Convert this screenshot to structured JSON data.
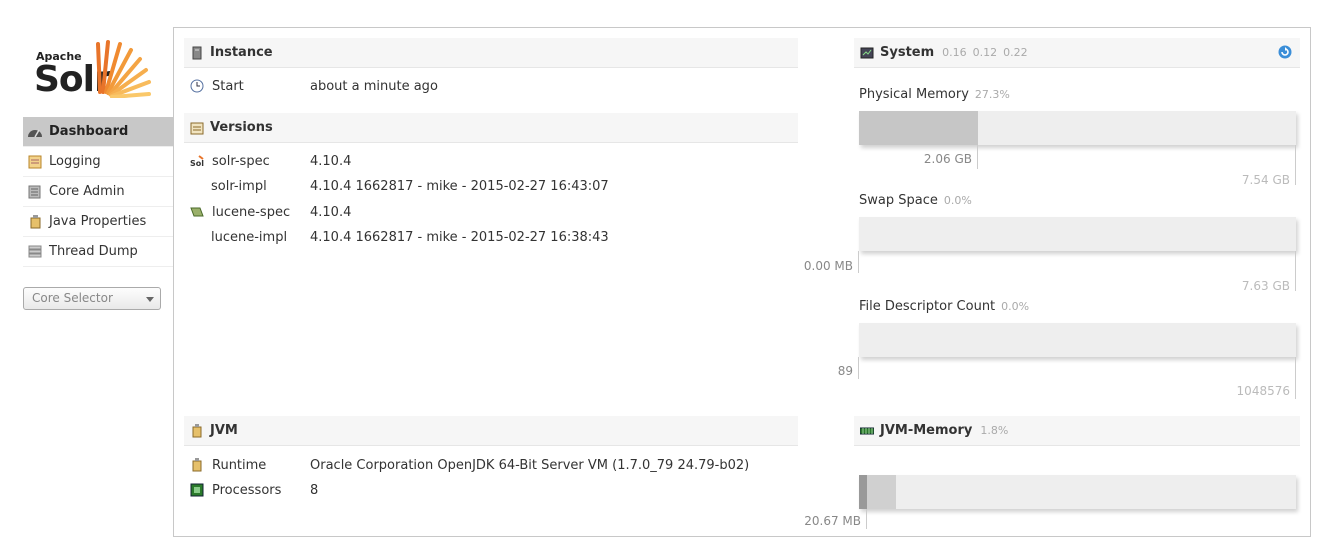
{
  "logo": {
    "top_text": "Apache",
    "main_text": "Solr"
  },
  "nav": [
    {
      "label": "Dashboard",
      "icon": "dashboard-icon",
      "active": true
    },
    {
      "label": "Logging",
      "icon": "logging-icon"
    },
    {
      "label": "Core Admin",
      "icon": "core-admin-icon"
    },
    {
      "label": "Java Properties",
      "icon": "java-properties-icon"
    },
    {
      "label": "Thread Dump",
      "icon": "thread-dump-icon"
    }
  ],
  "core_selector": {
    "placeholder": "Core Selector"
  },
  "instance": {
    "title": "Instance",
    "start_label": "Start",
    "start_value": "about a minute ago"
  },
  "versions": {
    "title": "Versions",
    "rows": [
      {
        "key": "solr-spec",
        "value": "4.10.4"
      },
      {
        "key": "solr-impl",
        "value": "4.10.4 1662817 - mike - 2015-02-27 16:43:07"
      },
      {
        "key": "lucene-spec",
        "value": "4.10.4"
      },
      {
        "key": "lucene-impl",
        "value": "4.10.4 1662817 - mike - 2015-02-27 16:38:43"
      }
    ]
  },
  "jvm": {
    "title": "JVM",
    "runtime_label": "Runtime",
    "runtime_value": "Oracle Corporation OpenJDK 64-Bit Server VM (1.7.0_79 24.79-b02)",
    "processors_label": "Processors",
    "processors_value": "8"
  },
  "system": {
    "title": "System",
    "load": [
      "0.16",
      "0.12",
      "0.22"
    ],
    "physical_memory": {
      "label": "Physical Memory",
      "pct": "27.3%",
      "used": "2.06 GB",
      "total": "7.54 GB",
      "fraction": 0.273
    },
    "swap": {
      "label": "Swap Space",
      "pct": "0.0%",
      "used": "0.00 MB",
      "total": "7.63 GB",
      "fraction": 0.0
    },
    "fd": {
      "label": "File Descriptor Count",
      "pct": "0.0%",
      "used": "89",
      "total": "1048576",
      "fraction": 0.0
    }
  },
  "jvm_memory": {
    "title": "JVM-Memory",
    "pct": "1.8%",
    "used_partial": "20.67 MB",
    "fraction_used": 0.018,
    "fraction_allocated": 0.085
  },
  "colors": {
    "active_nav": "#c8c8c8",
    "bar_bg": "#eeeeee",
    "bar_fill": "#c6c6c6"
  }
}
